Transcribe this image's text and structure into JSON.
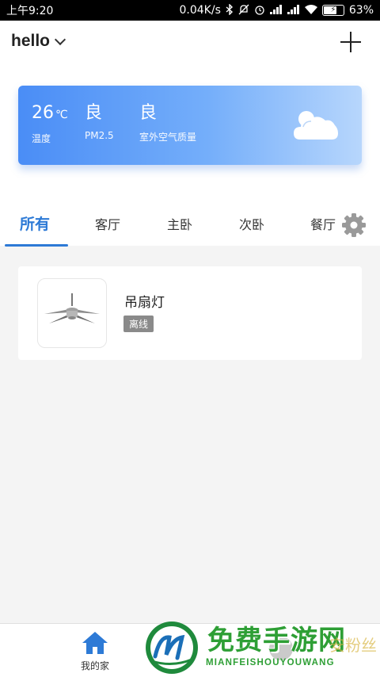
{
  "status_bar": {
    "time": "上午9:20",
    "network_speed": "0.04K/s",
    "battery_percent": "63%",
    "icons": [
      "bluetooth-icon",
      "mute-icon",
      "alarm-icon",
      "signal-icon",
      "signal-icon",
      "wifi-icon",
      "battery-charging-icon"
    ]
  },
  "header": {
    "home_name": "hello",
    "add_icon": "plus-icon",
    "dropdown_icon": "chevron-down-icon"
  },
  "weather": {
    "temperature": "26",
    "temperature_unit": "℃",
    "temperature_label": "温度",
    "pm25_value": "良",
    "pm25_label": "PM2.5",
    "air_quality_value": "良",
    "air_quality_label": "室外空气质量",
    "icon": "cloudy-icon"
  },
  "tabs": [
    {
      "label": "所有",
      "active": true
    },
    {
      "label": "客厅",
      "active": false
    },
    {
      "label": "主卧",
      "active": false
    },
    {
      "label": "次卧",
      "active": false
    },
    {
      "label": "餐厅",
      "active": false
    }
  ],
  "devices": [
    {
      "name": "吊扇灯",
      "status": "离线",
      "icon": "ceiling-fan-icon"
    }
  ],
  "bottom_nav": {
    "items": [
      {
        "label": "我的家",
        "icon": "home-icon"
      }
    ]
  },
  "watermark": {
    "title": "免费手游网",
    "subtitle": "MIANFEISHOUYOUWANG",
    "side_text": "安粉丝"
  },
  "colors": {
    "accent": "#2d7ad6",
    "weather_gradient_start": "#4a8df6",
    "weather_gradient_end": "#b7d6fc",
    "offline_badge": "#8a8a8a",
    "watermark_green": "#2e9f35"
  }
}
